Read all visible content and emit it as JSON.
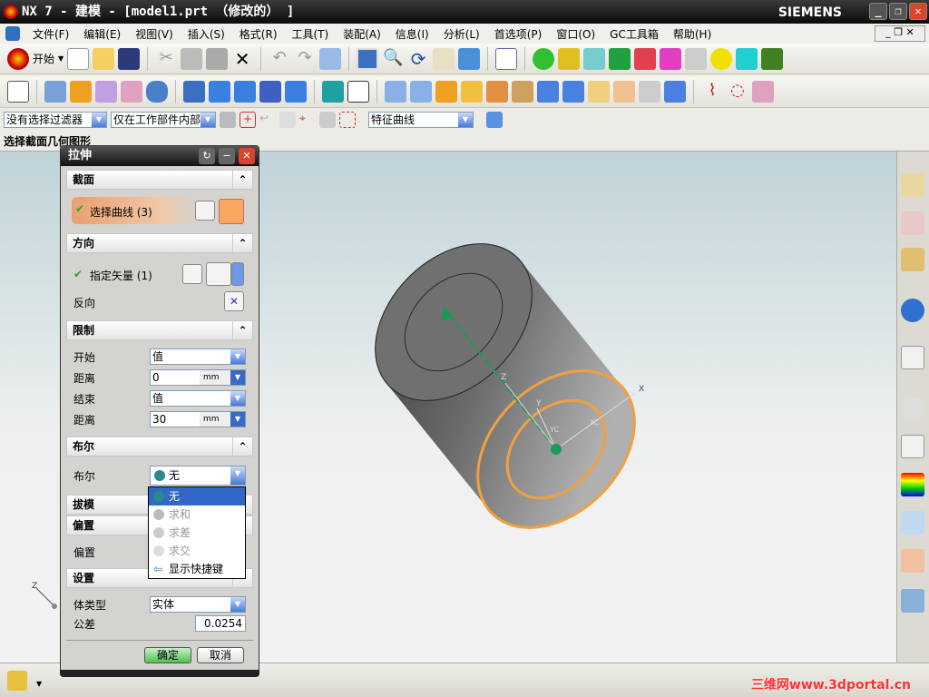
{
  "window": {
    "title": "NX 7 - 建模 - [model1.prt （修改的） ]",
    "brand": "SIEMENS"
  },
  "menu": [
    "文件(F)",
    "编辑(E)",
    "视图(V)",
    "插入(S)",
    "格式(R)",
    "工具(T)",
    "装配(A)",
    "信息(I)",
    "分析(L)",
    "首选项(P)",
    "窗口(O)",
    "GC工具箱",
    "帮助(H)"
  ],
  "toolbar": {
    "start_label": "开始"
  },
  "filterbar": {
    "type_filter": "没有选择过滤器",
    "scope_filter": "仅在工作部件内部",
    "curve_rule": "特征曲线"
  },
  "cue_line": "选择截面几何图形",
  "dialog": {
    "title": "拉伸",
    "sections": {
      "section": "截面",
      "direction": "方向",
      "limits": "限制",
      "boolean": "布尔",
      "draft": "拔模",
      "offset": "偏置",
      "settings": "设置"
    },
    "select_curve": "选择曲线 (3)",
    "specify_vector": "指定矢量 (1)",
    "reverse": "反向",
    "start_label": "开始",
    "start_value": "值",
    "start_distance_label": "距离",
    "start_distance": "0",
    "unit": "mm",
    "end_label": "结束",
    "end_value": "值",
    "end_distance_label": "距离",
    "end_distance": "30",
    "boolean_label": "布尔",
    "boolean_value": "无",
    "boolean_options": [
      "无",
      "求和",
      "求差",
      "求交",
      "显示快捷键"
    ],
    "offset_label": "偏置",
    "body_type_label": "体类型",
    "body_type": "实体",
    "tolerance_label": "公差",
    "tolerance": "0.0254",
    "ok": "确定",
    "cancel": "取消"
  },
  "viewport": {
    "axis_labels": {
      "z": "Z",
      "y": "Y",
      "x": "X",
      "yc": "YC",
      "xc": "XC"
    },
    "highlight_color": "#f0a040",
    "vector_color": "#1a9a5a"
  },
  "watermark": "三维网www.3dportal.cn"
}
